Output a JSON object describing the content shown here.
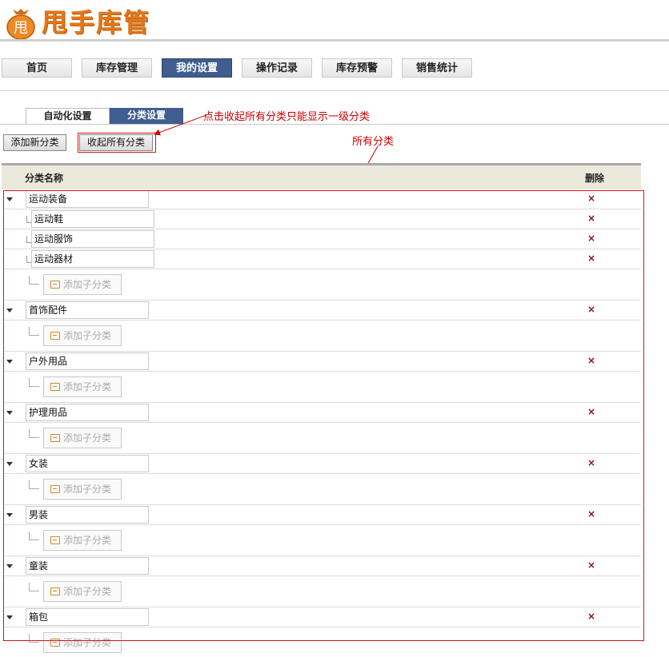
{
  "app": {
    "logo_char": "甩",
    "title": "甩手库管"
  },
  "nav": [
    "首页",
    "库存管理",
    "我的设置",
    "操作记录",
    "库存预警",
    "销售统计"
  ],
  "nav_active_index": 2,
  "tabs": [
    "自动化设置",
    "分类设置"
  ],
  "tabs_active_index": 1,
  "actions": {
    "add_category": "添加新分类",
    "collapse_all": "收起所有分类"
  },
  "annotations": {
    "collapse_note": "点击收起所有分类只能显示一级分类",
    "all_categories": "所有分类"
  },
  "table": {
    "col_name": "分类名称",
    "col_delete": "删除",
    "delete_symbol": "×",
    "add_child_label": "添加子分类"
  },
  "categories": [
    {
      "name": "运动装备",
      "children": [
        "运动鞋",
        "运动服饰",
        "运动器材"
      ]
    },
    {
      "name": "首饰配件",
      "children": []
    },
    {
      "name": "户外用品",
      "children": []
    },
    {
      "name": "护理用品",
      "children": []
    },
    {
      "name": "女装",
      "children": []
    },
    {
      "name": "男装",
      "children": []
    },
    {
      "name": "童装",
      "children": []
    },
    {
      "name": "箱包",
      "children": []
    }
  ],
  "colors": {
    "accent_nav": "#3f5d8f",
    "logo": "#e0781a",
    "annotation": "#cc0000",
    "delete": "#8b1010"
  }
}
